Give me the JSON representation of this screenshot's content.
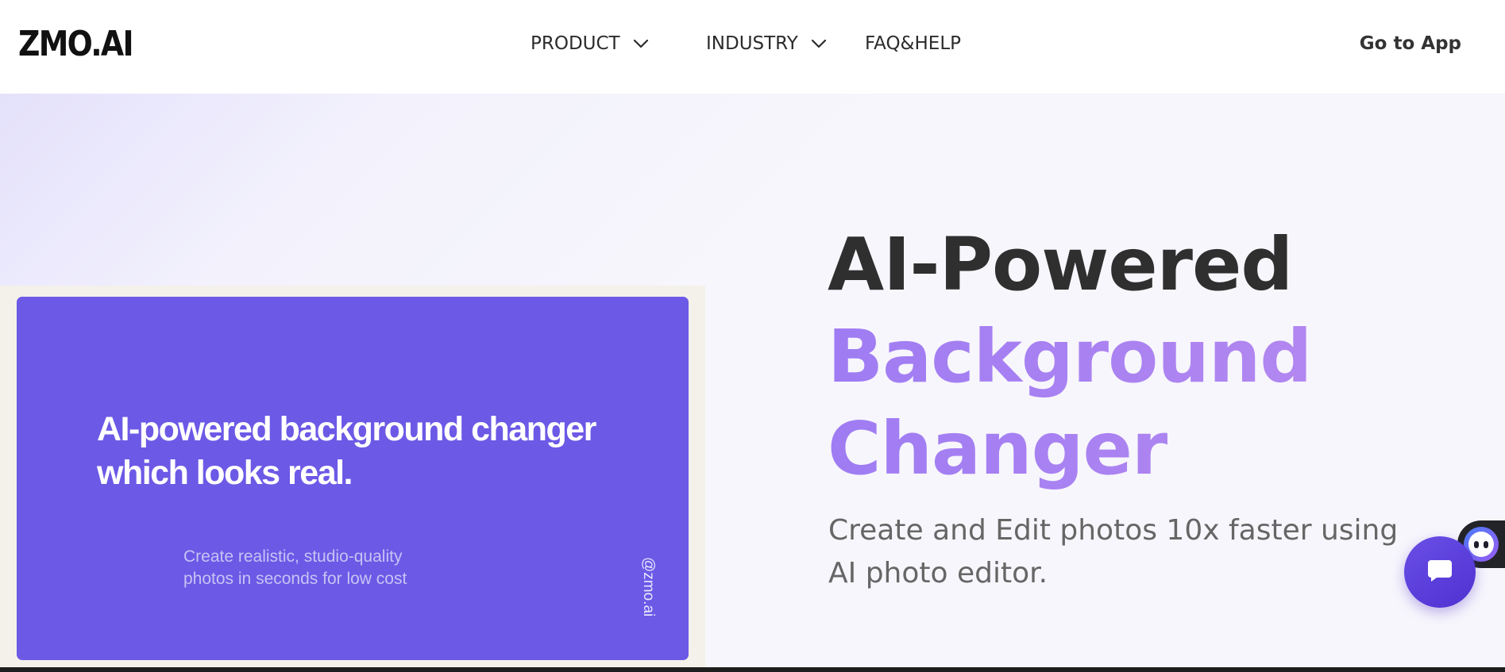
{
  "header": {
    "logo": "ZMO.AI",
    "nav": [
      {
        "label": "PRODUCT",
        "icon": "chevron-down-icon"
      },
      {
        "label": "INDUSTRY",
        "icon": "chevron-down-icon"
      },
      {
        "label": "FAQ&HELP"
      }
    ],
    "cta": "Go to App"
  },
  "hero": {
    "title_line1": "AI-Powered",
    "title_line2": "Background",
    "title_line3": "Changer",
    "subtitle": "Create and Edit photos 10x faster using AI photo editor.",
    "video": {
      "headline": "AI-powered background changer which looks real.",
      "subtext": "Create realistic, studio-quality photos in seconds for low cost",
      "handle": "@zmo.ai"
    }
  },
  "widgets": {
    "chat_icon": "chat-bubble-icon",
    "assistant_icon": "robot-face-icon"
  },
  "colors": {
    "accent": "#6c59e6",
    "title_gradient_start": "#9f7cf3",
    "title_gradient_end": "#b287f0",
    "chat_button": "#5a3ddb"
  }
}
